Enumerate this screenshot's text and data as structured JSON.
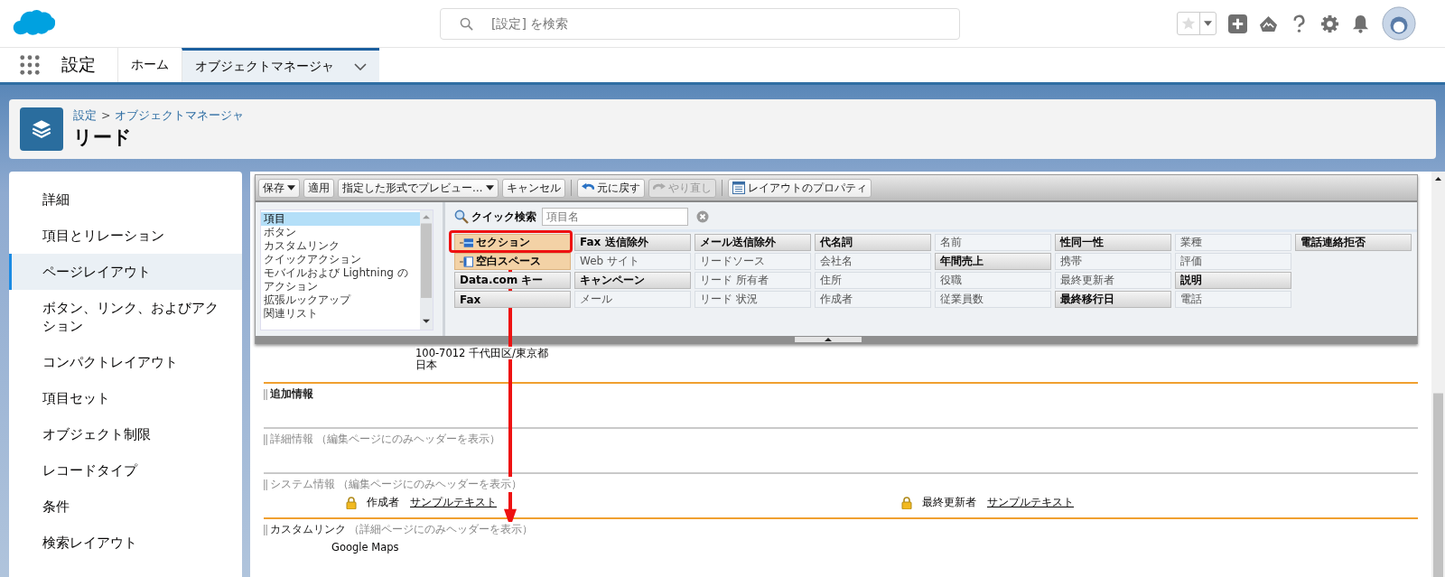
{
  "header": {
    "search": {
      "placeholder": "[設定] を検索"
    }
  },
  "nav": {
    "app_name": "設定",
    "tabs": [
      {
        "label": "ホーム",
        "selected": false,
        "dropdown": false
      },
      {
        "label": "オブジェクトマネージャ",
        "selected": true,
        "dropdown": true
      }
    ]
  },
  "page_header": {
    "breadcrumb": [
      "設定",
      "オブジェクトマネージャ"
    ],
    "separator": ">",
    "title": "リード"
  },
  "sidebar": {
    "items": [
      {
        "label": "詳細",
        "selected": false
      },
      {
        "label": "項目とリレーション",
        "selected": false
      },
      {
        "label": "ページレイアウト",
        "selected": true
      },
      {
        "label": "ボタン、リンク、およびアクション",
        "selected": false
      },
      {
        "label": "コンパクトレイアウト",
        "selected": false
      },
      {
        "label": "項目セット",
        "selected": false
      },
      {
        "label": "オブジェクト制限",
        "selected": false
      },
      {
        "label": "レコードタイプ",
        "selected": false
      },
      {
        "label": "条件",
        "selected": false
      },
      {
        "label": "検索レイアウト",
        "selected": false
      }
    ]
  },
  "palette": {
    "toolbar": [
      {
        "label": "保存",
        "kind": "split",
        "disabled": false
      },
      {
        "label": "適用",
        "kind": "plain",
        "disabled": false
      },
      {
        "label": "指定した形式でプレビュー…",
        "kind": "split",
        "disabled": false
      },
      {
        "label": "キャンセル",
        "kind": "plain",
        "disabled": false
      },
      {
        "label": "元に戻す",
        "kind": "undo",
        "disabled": false
      },
      {
        "label": "やり直し",
        "kind": "redo",
        "disabled": true
      },
      {
        "label": "レイアウトのプロパティ",
        "kind": "properties",
        "disabled": false
      }
    ],
    "categories": [
      {
        "label": "項目",
        "selected": true
      },
      {
        "label": "ボタン",
        "selected": false
      },
      {
        "label": "カスタムリンク",
        "selected": false
      },
      {
        "label": "クイックアクション",
        "selected": false
      },
      {
        "label": "モバイルおよび Lightning のアクション",
        "selected": false
      },
      {
        "label": "拡張ルックアップ",
        "selected": false
      },
      {
        "label": "関連リスト",
        "selected": false
      }
    ],
    "quick_search": {
      "label": "クイック検索",
      "placeholder": "項目名"
    },
    "fields": [
      [
        {
          "label": "セクション",
          "kind": "section"
        },
        {
          "label": "Fax 送信除外",
          "kind": "available"
        },
        {
          "label": "メール送信除外",
          "kind": "available"
        },
        {
          "label": "代名詞",
          "kind": "available"
        },
        {
          "label": "名前",
          "kind": "used"
        },
        {
          "label": "性同一性",
          "kind": "available"
        },
        {
          "label": "業種",
          "kind": "used"
        },
        {
          "label": "電話連絡拒否",
          "kind": "available"
        }
      ],
      [
        {
          "label": "空白スペース",
          "kind": "blank"
        },
        {
          "label": "Web サイト",
          "kind": "used"
        },
        {
          "label": "リードソース",
          "kind": "used"
        },
        {
          "label": "会社名",
          "kind": "used"
        },
        {
          "label": "年間売上",
          "kind": "available"
        },
        {
          "label": "携帯",
          "kind": "used"
        },
        {
          "label": "評価",
          "kind": "used"
        }
      ],
      [
        {
          "label": "Data.com キー",
          "kind": "available"
        },
        {
          "label": "キャンペーン",
          "kind": "available"
        },
        {
          "label": "リード 所有者",
          "kind": "used"
        },
        {
          "label": "住所",
          "kind": "used"
        },
        {
          "label": "役職",
          "kind": "used"
        },
        {
          "label": "最終更新者",
          "kind": "used"
        },
        {
          "label": "説明",
          "kind": "available"
        }
      ],
      [
        {
          "label": "Fax",
          "kind": "available"
        },
        {
          "label": "メール",
          "kind": "used"
        },
        {
          "label": "リード 状況",
          "kind": "used"
        },
        {
          "label": "作成者",
          "kind": "used"
        },
        {
          "label": "従業員数",
          "kind": "used"
        },
        {
          "label": "最終移行日",
          "kind": "available"
        },
        {
          "label": "電話",
          "kind": "used"
        }
      ]
    ]
  },
  "layout": {
    "address_lines": [
      "100-7012 千代田区/東京都",
      "日本"
    ],
    "sections": [
      {
        "title": "追加情報",
        "emphasized": true,
        "muted": false
      },
      {
        "title": "詳細情報",
        "note": "（編集ページにのみヘッダーを表示）",
        "emphasized": false,
        "muted": true
      },
      {
        "title": "システム情報",
        "note": "（編集ページにのみヘッダーを表示）",
        "emphasized": false,
        "muted": true,
        "fields": [
          {
            "label": "作成者",
            "value": "サンプルテキスト",
            "locked": true
          },
          {
            "label": "最終更新者",
            "value": "サンプルテキスト",
            "locked": true
          }
        ]
      },
      {
        "title": "カスタムリンク",
        "note": "（詳細ページにのみヘッダーを表示）",
        "emphasized": true,
        "muted": false,
        "links": [
          "Google Maps"
        ]
      }
    ]
  }
}
